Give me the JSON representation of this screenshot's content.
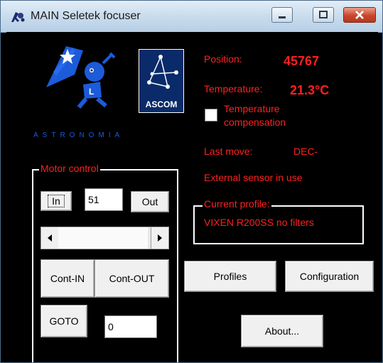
{
  "window": {
    "title": "MAIN Seletek focuser"
  },
  "logo": {
    "astronomia_text": "ASTRONOMIA",
    "ascom_text": "ASCOM"
  },
  "status": {
    "position_label": "Position:",
    "position_value": "45767",
    "temperature_label": "Temperature:",
    "temperature_value": "21.3°C",
    "temp_comp_label_line1": "Temperature",
    "temp_comp_label_line2": "compensation",
    "temp_comp_checked": false,
    "last_move_label": "Last move:",
    "last_move_value": "DEC-",
    "external_sensor": "External sensor in use"
  },
  "profile": {
    "group_title": "Current profile:",
    "name": "VIXEN R200SS no filters"
  },
  "motor": {
    "group_title": "Motor control",
    "in_label": "In",
    "step_value": "51",
    "out_label": "Out",
    "cont_in_label": "Cont-IN",
    "cont_out_label": "Cont-OUT",
    "goto_label": "GOTO",
    "goto_value": "0"
  },
  "buttons": {
    "profiles": "Profiles",
    "configuration": "Configuration",
    "about": "About..."
  },
  "icons": {
    "minimize": "minimize-icon",
    "maximize": "maximize-icon",
    "close": "close-icon"
  }
}
